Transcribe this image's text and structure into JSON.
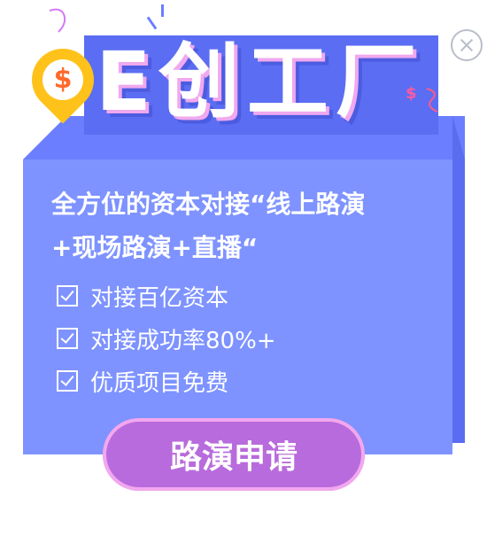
{
  "title": "E创工厂",
  "headline": {
    "line1": "全方位的资本对接“线上路演",
    "line2": "+现场路演+直播“"
  },
  "features": [
    {
      "label": "对接百亿资本"
    },
    {
      "label": "对接成功率80%+"
    },
    {
      "label": "优质项目免费"
    }
  ],
  "cta": {
    "label": "路演申请"
  },
  "icons": {
    "close": "close-icon",
    "pin": "money-pin-icon",
    "check": "checkbox-icon"
  },
  "pin_symbol": "$",
  "deco_dollar": "$",
  "colors": {
    "box": "#7e93ff",
    "box_dark": "#5a6cf0",
    "pin": "#ffc21a",
    "cta": "#b86bdc",
    "cta_border": "#f2a7ef"
  }
}
